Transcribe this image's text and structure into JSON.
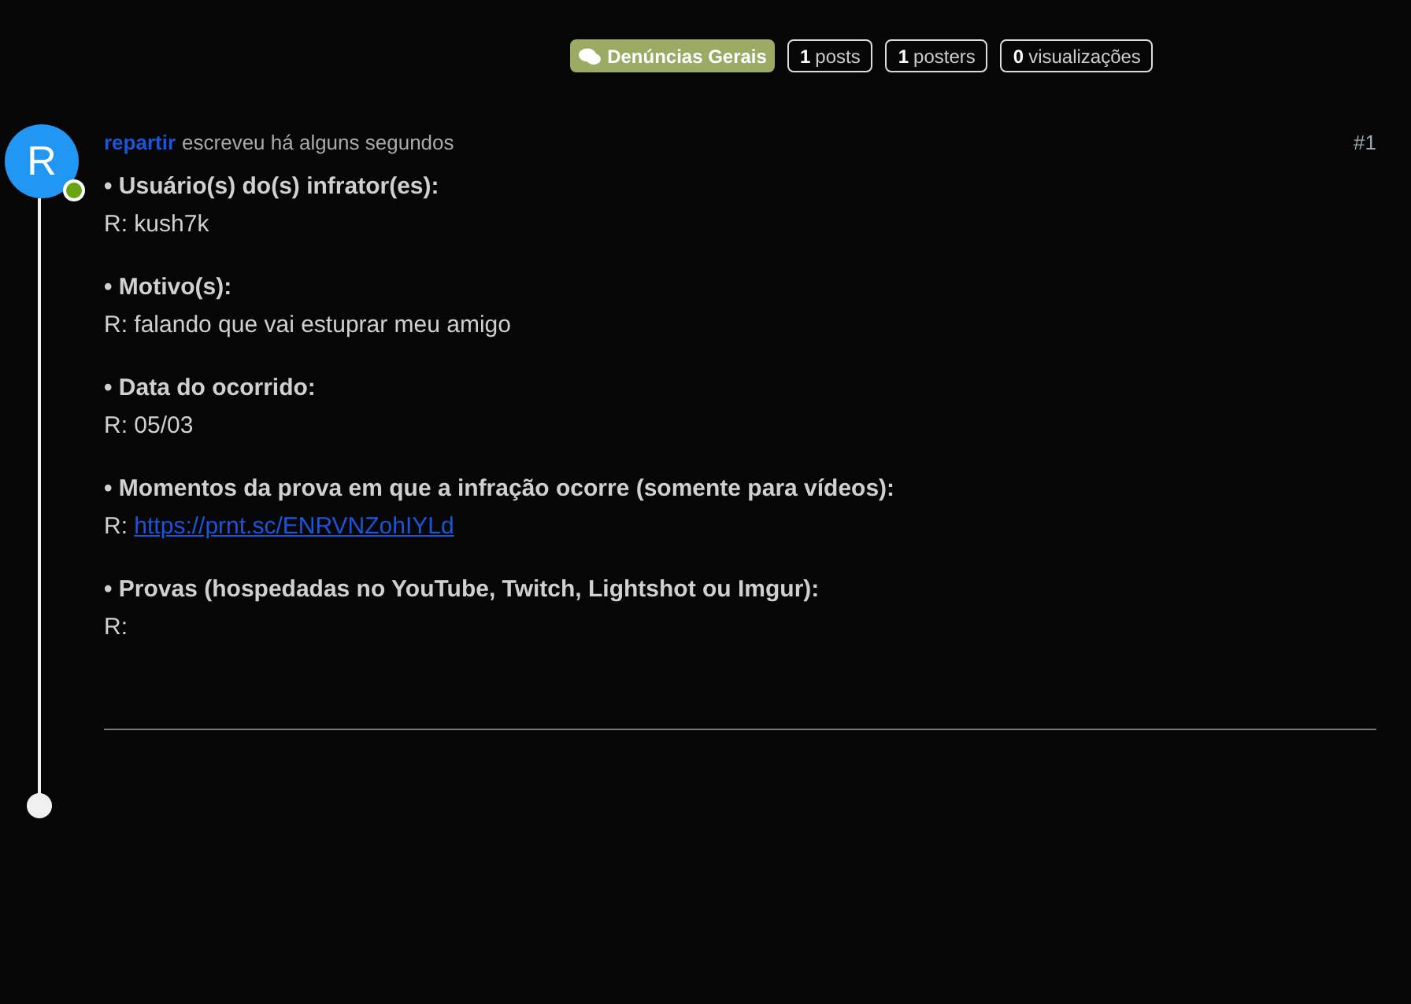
{
  "topic_meta": {
    "category": {
      "label": "Denúncias Gerais",
      "color": "#9bab64"
    },
    "stats": [
      {
        "count": "1",
        "label": "posts"
      },
      {
        "count": "1",
        "label": "posters"
      },
      {
        "count": "0",
        "label": "visualizações"
      }
    ]
  },
  "post": {
    "avatar_letter": "R",
    "online": true,
    "author": "repartir",
    "meta": "escreveu há alguns segundos",
    "index": "#1",
    "sections": [
      {
        "label": "• Usuário(s) do(s) infrator(es):",
        "answer_prefix": "R: ",
        "answer": "kush7k",
        "kind": "text"
      },
      {
        "label": "• Motivo(s):",
        "answer_prefix": "R: ",
        "answer": "falando que vai estuprar meu amigo",
        "kind": "text"
      },
      {
        "label": "• Data do ocorrido:",
        "answer_prefix": "R: ",
        "answer": "05/03",
        "kind": "text"
      },
      {
        "label": "• Momentos da prova em que a infração ocorre (somente para vídeos):",
        "answer_prefix": "R: ",
        "answer": "https://prnt.sc/ENRVNZohIYLd",
        "kind": "link"
      },
      {
        "label": "• Provas (hospedadas no YouTube, Twitch, Lightshot ou Imgur):",
        "answer_prefix": "R:"
      }
    ]
  }
}
